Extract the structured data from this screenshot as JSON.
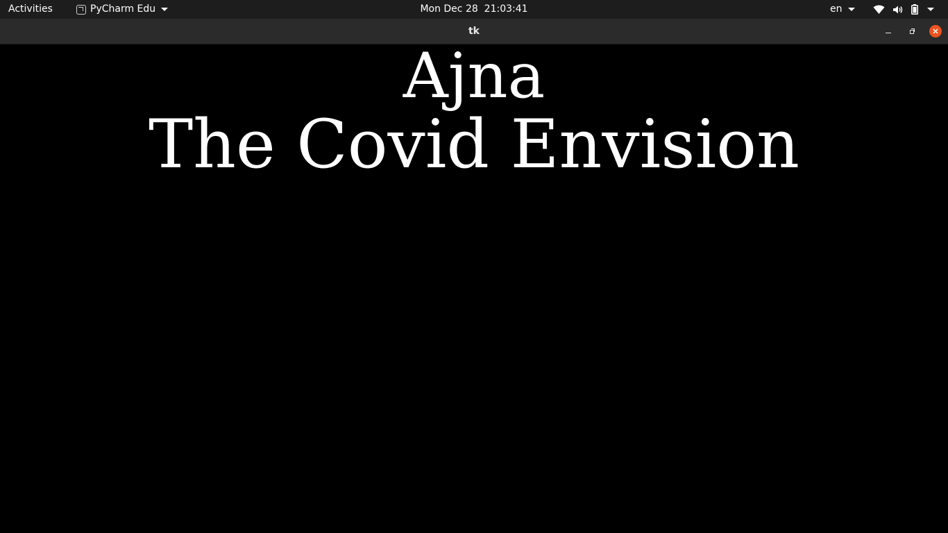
{
  "topbar": {
    "activities_label": "Activities",
    "app_menu_label": "PyCharm Edu",
    "app_icon": "pycharm-icon",
    "clock": "Mon Dec 28  21:03:41",
    "language": "en",
    "status_icons": [
      "wifi-icon",
      "volume-icon",
      "battery-icon",
      "system-menu-caret-icon"
    ]
  },
  "window": {
    "title": "tk",
    "controls": [
      "minimize-icon",
      "maximize-icon",
      "close-icon"
    ],
    "close_button_color": "#e95420"
  },
  "content": {
    "background": "#000000",
    "text_color": "#ffffff",
    "line1": "Ajna",
    "line2": "The Covid Envision"
  }
}
